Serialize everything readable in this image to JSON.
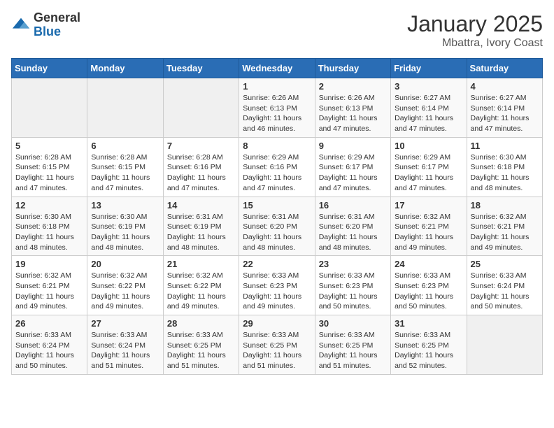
{
  "logo": {
    "general": "General",
    "blue": "Blue"
  },
  "title": "January 2025",
  "location": "Mbattra, Ivory Coast",
  "weekdays": [
    "Sunday",
    "Monday",
    "Tuesday",
    "Wednesday",
    "Thursday",
    "Friday",
    "Saturday"
  ],
  "weeks": [
    [
      {
        "day": "",
        "info": ""
      },
      {
        "day": "",
        "info": ""
      },
      {
        "day": "",
        "info": ""
      },
      {
        "day": "1",
        "sunrise": "6:26 AM",
        "sunset": "6:13 PM",
        "daylight": "11 hours and 46 minutes."
      },
      {
        "day": "2",
        "sunrise": "6:26 AM",
        "sunset": "6:13 PM",
        "daylight": "11 hours and 47 minutes."
      },
      {
        "day": "3",
        "sunrise": "6:27 AM",
        "sunset": "6:14 PM",
        "daylight": "11 hours and 47 minutes."
      },
      {
        "day": "4",
        "sunrise": "6:27 AM",
        "sunset": "6:14 PM",
        "daylight": "11 hours and 47 minutes."
      }
    ],
    [
      {
        "day": "5",
        "sunrise": "6:28 AM",
        "sunset": "6:15 PM",
        "daylight": "11 hours and 47 minutes."
      },
      {
        "day": "6",
        "sunrise": "6:28 AM",
        "sunset": "6:15 PM",
        "daylight": "11 hours and 47 minutes."
      },
      {
        "day": "7",
        "sunrise": "6:28 AM",
        "sunset": "6:16 PM",
        "daylight": "11 hours and 47 minutes."
      },
      {
        "day": "8",
        "sunrise": "6:29 AM",
        "sunset": "6:16 PM",
        "daylight": "11 hours and 47 minutes."
      },
      {
        "day": "9",
        "sunrise": "6:29 AM",
        "sunset": "6:17 PM",
        "daylight": "11 hours and 47 minutes."
      },
      {
        "day": "10",
        "sunrise": "6:29 AM",
        "sunset": "6:17 PM",
        "daylight": "11 hours and 47 minutes."
      },
      {
        "day": "11",
        "sunrise": "6:30 AM",
        "sunset": "6:18 PM",
        "daylight": "11 hours and 48 minutes."
      }
    ],
    [
      {
        "day": "12",
        "sunrise": "6:30 AM",
        "sunset": "6:18 PM",
        "daylight": "11 hours and 48 minutes."
      },
      {
        "day": "13",
        "sunrise": "6:30 AM",
        "sunset": "6:19 PM",
        "daylight": "11 hours and 48 minutes."
      },
      {
        "day": "14",
        "sunrise": "6:31 AM",
        "sunset": "6:19 PM",
        "daylight": "11 hours and 48 minutes."
      },
      {
        "day": "15",
        "sunrise": "6:31 AM",
        "sunset": "6:20 PM",
        "daylight": "11 hours and 48 minutes."
      },
      {
        "day": "16",
        "sunrise": "6:31 AM",
        "sunset": "6:20 PM",
        "daylight": "11 hours and 48 minutes."
      },
      {
        "day": "17",
        "sunrise": "6:32 AM",
        "sunset": "6:21 PM",
        "daylight": "11 hours and 49 minutes."
      },
      {
        "day": "18",
        "sunrise": "6:32 AM",
        "sunset": "6:21 PM",
        "daylight": "11 hours and 49 minutes."
      }
    ],
    [
      {
        "day": "19",
        "sunrise": "6:32 AM",
        "sunset": "6:21 PM",
        "daylight": "11 hours and 49 minutes."
      },
      {
        "day": "20",
        "sunrise": "6:32 AM",
        "sunset": "6:22 PM",
        "daylight": "11 hours and 49 minutes."
      },
      {
        "day": "21",
        "sunrise": "6:32 AM",
        "sunset": "6:22 PM",
        "daylight": "11 hours and 49 minutes."
      },
      {
        "day": "22",
        "sunrise": "6:33 AM",
        "sunset": "6:23 PM",
        "daylight": "11 hours and 49 minutes."
      },
      {
        "day": "23",
        "sunrise": "6:33 AM",
        "sunset": "6:23 PM",
        "daylight": "11 hours and 50 minutes."
      },
      {
        "day": "24",
        "sunrise": "6:33 AM",
        "sunset": "6:23 PM",
        "daylight": "11 hours and 50 minutes."
      },
      {
        "day": "25",
        "sunrise": "6:33 AM",
        "sunset": "6:24 PM",
        "daylight": "11 hours and 50 minutes."
      }
    ],
    [
      {
        "day": "26",
        "sunrise": "6:33 AM",
        "sunset": "6:24 PM",
        "daylight": "11 hours and 50 minutes."
      },
      {
        "day": "27",
        "sunrise": "6:33 AM",
        "sunset": "6:24 PM",
        "daylight": "11 hours and 51 minutes."
      },
      {
        "day": "28",
        "sunrise": "6:33 AM",
        "sunset": "6:25 PM",
        "daylight": "11 hours and 51 minutes."
      },
      {
        "day": "29",
        "sunrise": "6:33 AM",
        "sunset": "6:25 PM",
        "daylight": "11 hours and 51 minutes."
      },
      {
        "day": "30",
        "sunrise": "6:33 AM",
        "sunset": "6:25 PM",
        "daylight": "11 hours and 51 minutes."
      },
      {
        "day": "31",
        "sunrise": "6:33 AM",
        "sunset": "6:25 PM",
        "daylight": "11 hours and 52 minutes."
      },
      {
        "day": "",
        "info": ""
      }
    ]
  ],
  "labels": {
    "sunrise_prefix": "Sunrise: ",
    "sunset_prefix": "Sunset: ",
    "daylight_prefix": "Daylight: "
  }
}
